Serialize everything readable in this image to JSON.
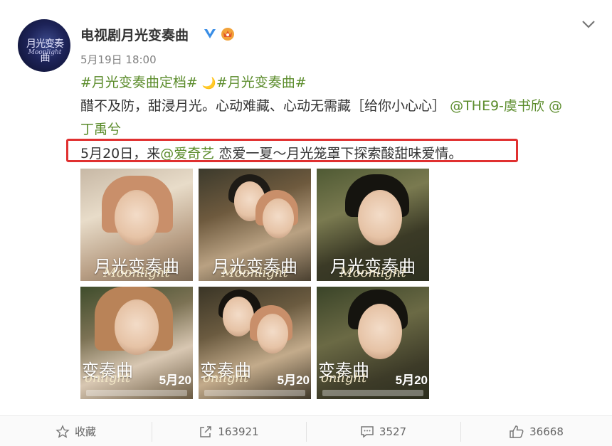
{
  "post": {
    "avatar": {
      "title": "月光变奏曲",
      "subtitle": "Moonlight"
    },
    "username": "电视剧月光变奏曲",
    "timestamp": "5月19日 18:00",
    "hashtag1": "#月光变奏曲定档#",
    "moon_icon": "🌙",
    "hashtag2": "#月光变奏曲#",
    "line2_text": "醋不及防，甜浸月光。心动难藏、心动无需藏［给你小心心］",
    "mention1": "@THE9-虞书欣",
    "mention2_at": "@",
    "mention2_name": "丁禹兮",
    "line4_pre": "5月20日，来",
    "mention_iqiyi": "@爱奇艺",
    "line4_post": " 恋爱一夏～月光笼罩下探索酸甜味爱情。",
    "highlight_color": "#e03030",
    "link_color": "#5b8c2b"
  },
  "photos": [
    {
      "title": "月光变奏曲",
      "subtitle": "Moonlight",
      "date": ""
    },
    {
      "title": "月光变奏曲",
      "subtitle": "Moonlight",
      "date": ""
    },
    {
      "title": "月光变奏曲",
      "subtitle": "Moonlight",
      "date": ""
    },
    {
      "title": "变奏曲",
      "subtitle": "onlight",
      "date": "5月20"
    },
    {
      "title": "变奏曲",
      "subtitle": "onlight",
      "date": "5月20"
    },
    {
      "title": "变奏曲",
      "subtitle": "onlight",
      "date": "5月20"
    }
  ],
  "footer": {
    "favorite_label": "收藏",
    "repost_count": "163921",
    "comment_count": "3527",
    "like_count": "36668"
  },
  "icons": [
    "verified-icon",
    "vip-crown-icon",
    "chevron-down-icon",
    "star-icon",
    "share-icon",
    "comment-icon",
    "like-icon"
  ]
}
